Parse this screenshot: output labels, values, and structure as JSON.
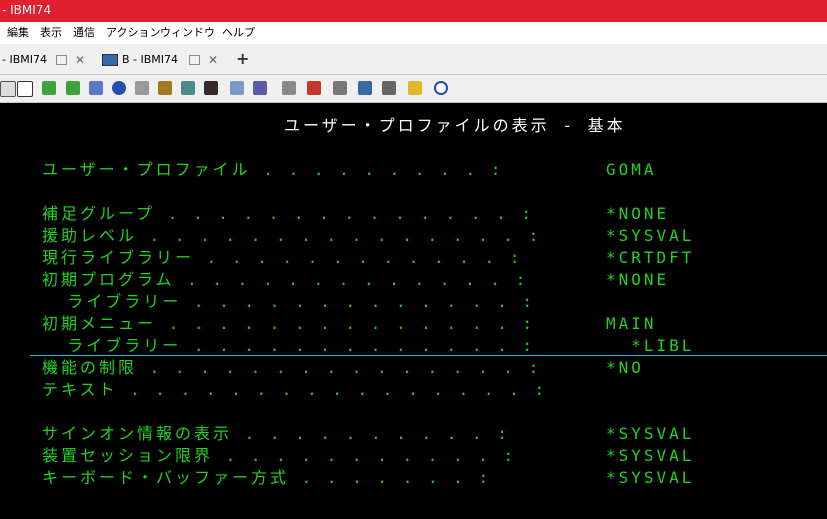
{
  "window": {
    "title": "- IBMI74"
  },
  "menu": [
    "編集",
    "表示",
    "通信",
    "アクション",
    "ウィンドウ",
    "ヘルプ"
  ],
  "tabs": [
    {
      "label": "- IBMI74"
    },
    {
      "label": "B - IBMI74"
    }
  ],
  "toolbar": {
    "icons": [
      "copy-icon",
      "paste-icon",
      "send-icon",
      "receive-icon",
      "print-icon",
      "compass-icon",
      "clipboard-icon",
      "macro-icon",
      "keypad-icon",
      "record-icon",
      "display-icon",
      "grid-icon",
      "settings-icon",
      "disk-icon",
      "queue-icon",
      "transfer-icon",
      "monitor-icon",
      "notes-icon",
      "help-icon"
    ]
  },
  "screen": {
    "title": "ユーザー・プロファイルの表示 - 基本",
    "lines": [
      {
        "label": "ユーザー・プロファイル . . . . . . . . . :",
        "value": "GOMA"
      },
      {
        "label": "補足グループ . . . . . . . . . . . . . . :",
        "value": "*NONE"
      },
      {
        "label": "援助レベル . . . . . . . . . . . . . . . :",
        "value": "*SYSVAL"
      },
      {
        "label": "現行ライブラリー . . . . . . . . . . . . :",
        "value": "*CRTDFT"
      },
      {
        "label": "初期プログラム . . . . . . . . . . . . . :",
        "value": "*NONE"
      },
      {
        "label": "  ライブラリー . . . . . . . . . . . . . :",
        "value": ""
      },
      {
        "label": "初期メニュー . . . . . . . . . . . . . . :",
        "value": "MAIN"
      },
      {
        "label": "  ライブラリー . . . . . . . . . . . . . :",
        "value": "  *LIBL"
      },
      {
        "label": "機能の制限 . . . . . . . . . . . . . . . :",
        "value": "*NO"
      },
      {
        "label": "テキスト . . . . . . . . . . . . . . . . :",
        "value": ""
      },
      {
        "label": "サインオン情報の表示 . . . . . . . . . . :",
        "value": "*SYSVAL"
      },
      {
        "label": "装置セッション限界 . . . . . . . . . . . :",
        "value": "*SYSVAL"
      },
      {
        "label": "キーボード・バッファー方式 . . . . . . . :",
        "value": "*SYSVAL"
      }
    ]
  },
  "colors": {
    "title_bar": "#e0202e",
    "terminal_fg": "#21d121",
    "terminal_title": "#ffffff",
    "cursor_line": "#1bc7cf"
  }
}
